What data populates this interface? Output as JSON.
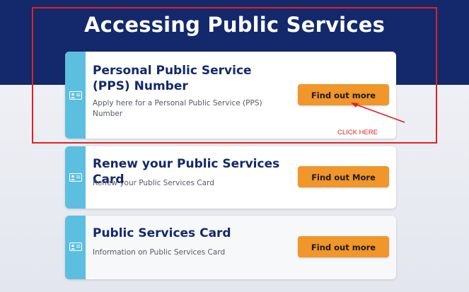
{
  "header": {
    "title": "Accessing Public Services"
  },
  "cards": [
    {
      "title": "Personal Public Service (PPS) Number",
      "description": "Apply here for a Personal Public Service (PPS) Number",
      "button": "Find out more",
      "icon": "id-card-icon"
    },
    {
      "title": "Renew your Public Services Card",
      "description": "Renew your Public Services Card",
      "button": "Find out More",
      "icon": "id-card-icon"
    },
    {
      "title": "Public Services Card",
      "description": "Information on Public Services Card",
      "button": "Find out more",
      "icon": "id-card-icon"
    }
  ],
  "annotation": {
    "text": "CLICK HERE",
    "color": "#e0221f"
  },
  "colors": {
    "header_bg": "#13296b",
    "stripe": "#5cbfe0",
    "button": "#f0962a"
  }
}
